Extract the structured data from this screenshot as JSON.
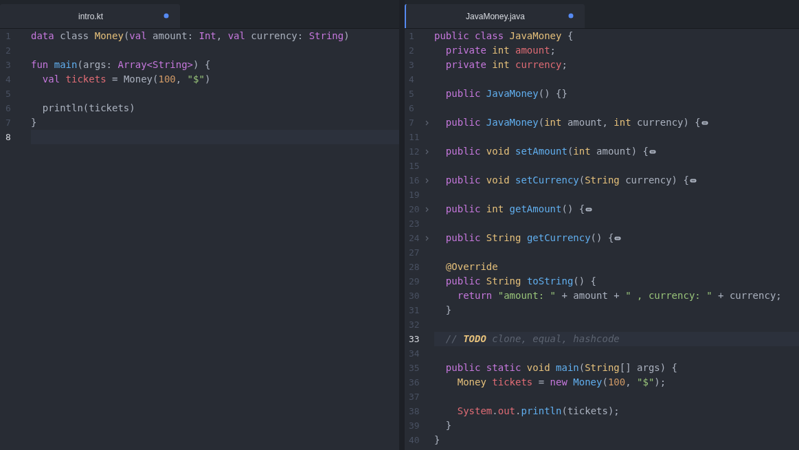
{
  "panes": [
    {
      "active": false,
      "tab": {
        "label": "intro.kt",
        "selected": true,
        "modified": true
      },
      "lines": [
        {
          "number": "1",
          "folded": false,
          "cursor": false,
          "tokens": [
            {
              "text": "data",
              "kind": "keyword"
            },
            {
              "text": " class ",
              "kind": "plain"
            },
            {
              "text": "Money",
              "kind": "type"
            },
            {
              "text": "(",
              "kind": "plain"
            },
            {
              "text": "val",
              "kind": "keyword"
            },
            {
              "text": " amount: ",
              "kind": "plain"
            },
            {
              "text": "Int",
              "kind": "keyword"
            },
            {
              "text": ", ",
              "kind": "plain"
            },
            {
              "text": "val",
              "kind": "keyword"
            },
            {
              "text": " currency: ",
              "kind": "plain"
            },
            {
              "text": "String",
              "kind": "keyword"
            },
            {
              "text": ")",
              "kind": "plain"
            }
          ]
        },
        {
          "number": "2",
          "folded": false,
          "cursor": false
        },
        {
          "number": "3",
          "folded": false,
          "cursor": false,
          "tokens": [
            {
              "text": "fun",
              "kind": "keyword"
            },
            {
              "text": " main",
              "kind": "function"
            },
            {
              "text": "(args: ",
              "kind": "plain"
            },
            {
              "text": "Array<String>",
              "kind": "keyword"
            },
            {
              "text": ") {",
              "kind": "plain"
            }
          ]
        },
        {
          "number": "4",
          "folded": false,
          "cursor": false,
          "tokens": [
            {
              "text": "  val",
              "kind": "keyword"
            },
            {
              "text": " tickets",
              "kind": "variable"
            },
            {
              "text": " = Money(",
              "kind": "plain"
            },
            {
              "text": "100",
              "kind": "number"
            },
            {
              "text": ", ",
              "kind": "plain"
            },
            {
              "text": "\"$\"",
              "kind": "string"
            },
            {
              "text": ")",
              "kind": "plain"
            }
          ]
        },
        {
          "number": "5",
          "folded": false,
          "cursor": false
        },
        {
          "number": "6",
          "folded": false,
          "cursor": false,
          "tokens": [
            {
              "text": "  println(tickets)",
              "kind": "plain"
            }
          ]
        },
        {
          "number": "7",
          "folded": false,
          "cursor": false,
          "tokens": [
            {
              "text": "}",
              "kind": "plain"
            }
          ]
        },
        {
          "number": "8",
          "folded": false,
          "cursor": true
        }
      ]
    },
    {
      "active": true,
      "tab": {
        "label": "JavaMoney.java",
        "selected": true,
        "modified": true
      },
      "lines": [
        {
          "number": "1",
          "folded": false,
          "cursor": false,
          "tokens": [
            {
              "text": "public class",
              "kind": "keyword"
            },
            {
              "text": " JavaMoney",
              "kind": "type"
            },
            {
              "text": " {",
              "kind": "plain"
            }
          ]
        },
        {
          "number": "2",
          "folded": false,
          "cursor": false,
          "tokens": [
            {
              "text": "  private",
              "kind": "keyword"
            },
            {
              "text": " int",
              "kind": "type"
            },
            {
              "text": " amount",
              "kind": "variable"
            },
            {
              "text": ";",
              "kind": "plain"
            }
          ]
        },
        {
          "number": "3",
          "folded": false,
          "cursor": false,
          "tokens": [
            {
              "text": "  private",
              "kind": "keyword"
            },
            {
              "text": " int",
              "kind": "type"
            },
            {
              "text": " currency",
              "kind": "variable"
            },
            {
              "text": ";",
              "kind": "plain"
            }
          ]
        },
        {
          "number": "4",
          "folded": false,
          "cursor": false
        },
        {
          "number": "5",
          "folded": false,
          "cursor": false,
          "tokens": [
            {
              "text": "  public",
              "kind": "keyword"
            },
            {
              "text": " JavaMoney",
              "kind": "function"
            },
            {
              "text": "() {}",
              "kind": "plain"
            }
          ]
        },
        {
          "number": "6",
          "folded": false,
          "cursor": false
        },
        {
          "number": "7",
          "folded": true,
          "cursor": false,
          "tokens": [
            {
              "text": "  public",
              "kind": "keyword"
            },
            {
              "text": " JavaMoney",
              "kind": "function"
            },
            {
              "text": "(",
              "kind": "plain"
            },
            {
              "text": "int",
              "kind": "type"
            },
            {
              "text": " amount, ",
              "kind": "plain"
            },
            {
              "text": "int",
              "kind": "type"
            },
            {
              "text": " currency) {",
              "kind": "plain"
            }
          ]
        },
        {
          "number": "11",
          "folded": false,
          "cursor": false
        },
        {
          "number": "12",
          "folded": true,
          "cursor": false,
          "tokens": [
            {
              "text": "  public",
              "kind": "keyword"
            },
            {
              "text": " void",
              "kind": "type"
            },
            {
              "text": " setAmount",
              "kind": "function"
            },
            {
              "text": "(",
              "kind": "plain"
            },
            {
              "text": "int",
              "kind": "type"
            },
            {
              "text": " amount) {",
              "kind": "plain"
            }
          ]
        },
        {
          "number": "15",
          "folded": false,
          "cursor": false
        },
        {
          "number": "16",
          "folded": true,
          "cursor": false,
          "tokens": [
            {
              "text": "  public",
              "kind": "keyword"
            },
            {
              "text": " void",
              "kind": "type"
            },
            {
              "text": " setCurrency",
              "kind": "function"
            },
            {
              "text": "(",
              "kind": "plain"
            },
            {
              "text": "String",
              "kind": "type"
            },
            {
              "text": " currency) {",
              "kind": "plain"
            }
          ]
        },
        {
          "number": "19",
          "folded": false,
          "cursor": false
        },
        {
          "number": "20",
          "folded": true,
          "cursor": false,
          "tokens": [
            {
              "text": "  public",
              "kind": "keyword"
            },
            {
              "text": " int",
              "kind": "type"
            },
            {
              "text": " getAmount",
              "kind": "function"
            },
            {
              "text": "() {",
              "kind": "plain"
            }
          ]
        },
        {
          "number": "23",
          "folded": false,
          "cursor": false
        },
        {
          "number": "24",
          "folded": true,
          "cursor": false,
          "tokens": [
            {
              "text": "  public",
              "kind": "keyword"
            },
            {
              "text": " String",
              "kind": "type"
            },
            {
              "text": " getCurrency",
              "kind": "function"
            },
            {
              "text": "() {",
              "kind": "plain"
            }
          ]
        },
        {
          "number": "27",
          "folded": false,
          "cursor": false
        },
        {
          "number": "28",
          "folded": false,
          "cursor": false,
          "tokens": [
            {
              "text": "  @Override",
              "kind": "type"
            }
          ]
        },
        {
          "number": "29",
          "folded": false,
          "cursor": false,
          "tokens": [
            {
              "text": "  public",
              "kind": "keyword"
            },
            {
              "text": " String",
              "kind": "type"
            },
            {
              "text": " toString",
              "kind": "function"
            },
            {
              "text": "() {",
              "kind": "plain"
            }
          ]
        },
        {
          "number": "30",
          "folded": false,
          "cursor": false,
          "tokens": [
            {
              "text": "    return",
              "kind": "keyword"
            },
            {
              "text": " \"amount: \"",
              "kind": "string"
            },
            {
              "text": " + amount + ",
              "kind": "plain"
            },
            {
              "text": "\" , currency: \"",
              "kind": "string"
            },
            {
              "text": " + currency;",
              "kind": "plain"
            }
          ]
        },
        {
          "number": "31",
          "folded": false,
          "cursor": false,
          "tokens": [
            {
              "text": "  }",
              "kind": "plain"
            }
          ]
        },
        {
          "number": "32",
          "folded": false,
          "cursor": false
        },
        {
          "number": "33",
          "folded": false,
          "cursor": true,
          "tokens": [
            {
              "text": "  //",
              "kind": "comment"
            },
            {
              "text": " TODO",
              "kind": "todo"
            },
            {
              "text": " clone, equal, hashcode",
              "kind": "comment"
            }
          ]
        },
        {
          "number": "34",
          "folded": false,
          "cursor": false
        },
        {
          "number": "35",
          "folded": false,
          "cursor": false,
          "tokens": [
            {
              "text": "  public static",
              "kind": "keyword"
            },
            {
              "text": " void",
              "kind": "type"
            },
            {
              "text": " main",
              "kind": "function"
            },
            {
              "text": "(",
              "kind": "plain"
            },
            {
              "text": "String",
              "kind": "type"
            },
            {
              "text": "[] args) {",
              "kind": "plain"
            }
          ]
        },
        {
          "number": "36",
          "folded": false,
          "cursor": false,
          "tokens": [
            {
              "text": "    Money",
              "kind": "type"
            },
            {
              "text": " tickets",
              "kind": "variable"
            },
            {
              "text": " = ",
              "kind": "plain"
            },
            {
              "text": "new",
              "kind": "keyword"
            },
            {
              "text": " Money",
              "kind": "function"
            },
            {
              "text": "(",
              "kind": "plain"
            },
            {
              "text": "100",
              "kind": "number"
            },
            {
              "text": ", ",
              "kind": "plain"
            },
            {
              "text": "\"$\"",
              "kind": "string"
            },
            {
              "text": ");",
              "kind": "plain"
            }
          ]
        },
        {
          "number": "37",
          "folded": false,
          "cursor": false
        },
        {
          "number": "38",
          "folded": false,
          "cursor": false,
          "tokens": [
            {
              "text": "    System",
              "kind": "variable"
            },
            {
              "text": ".",
              "kind": "plain"
            },
            {
              "text": "out",
              "kind": "variable"
            },
            {
              "text": ".",
              "kind": "plain"
            },
            {
              "text": "println",
              "kind": "function"
            },
            {
              "text": "(tickets);",
              "kind": "plain"
            }
          ]
        },
        {
          "number": "39",
          "folded": false,
          "cursor": false,
          "tokens": [
            {
              "text": "  }",
              "kind": "plain"
            }
          ]
        },
        {
          "number": "40",
          "folded": false,
          "cursor": false,
          "tokens": [
            {
              "text": "}",
              "kind": "plain"
            }
          ]
        }
      ]
    }
  ]
}
